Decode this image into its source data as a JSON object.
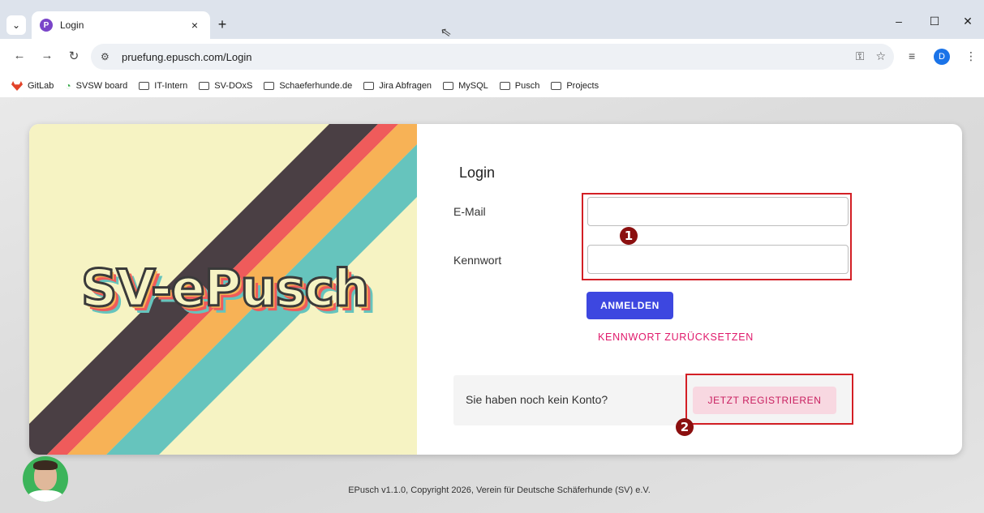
{
  "browser": {
    "tab_title": "Login",
    "tab_favicon_letter": "P",
    "tab_list_glyph": "⌄",
    "tab_close_glyph": "×",
    "new_tab_glyph": "+",
    "minimize_glyph": "–",
    "maximize_glyph": "☐",
    "close_glyph": "✕",
    "url": "pruefung.epusch.com/Login",
    "profile_initial": "D"
  },
  "bookmarks": [
    {
      "label": "GitLab",
      "icon": "gitlab-icon"
    },
    {
      "label": "SVSW board",
      "icon": "svsw-icon"
    },
    {
      "label": "IT-Intern",
      "icon": "folder-icon"
    },
    {
      "label": "SV-DOxS",
      "icon": "folder-icon"
    },
    {
      "label": "Schaeferhunde.de",
      "icon": "folder-icon"
    },
    {
      "label": "Jira Abfragen",
      "icon": "folder-icon"
    },
    {
      "label": "MySQL",
      "icon": "folder-icon"
    },
    {
      "label": "Pusch",
      "icon": "folder-icon"
    },
    {
      "label": "Projects",
      "icon": "folder-icon"
    }
  ],
  "banner": {
    "logo_text": "SV-ePusch",
    "stripe_colors": [
      "#4a3f44",
      "#ef5b5b",
      "#f7b256",
      "#66c4bd"
    ],
    "background": "#f6f3c3"
  },
  "login": {
    "title": "Login",
    "email_label": "E-Mail",
    "email_value": "",
    "password_label": "Kennwort",
    "password_value": "",
    "submit_label": "ANMELDEN",
    "reset_label": "KENNWORT ZURÜCKSETZEN"
  },
  "register": {
    "prompt": "Sie haben noch kein Konto?",
    "button_label": "JETZT REGISTRIEREN"
  },
  "annotations": [
    {
      "number": "1"
    },
    {
      "number": "2"
    }
  ],
  "colors": {
    "primary_button": "#3d47e0",
    "accent_pink": "#e0196b",
    "annotation_red": "#d31f25"
  },
  "footer": {
    "text": "EPusch v1.1.0, Copyright 2026, Verein für Deutsche Schäferhunde (SV) e.V."
  }
}
